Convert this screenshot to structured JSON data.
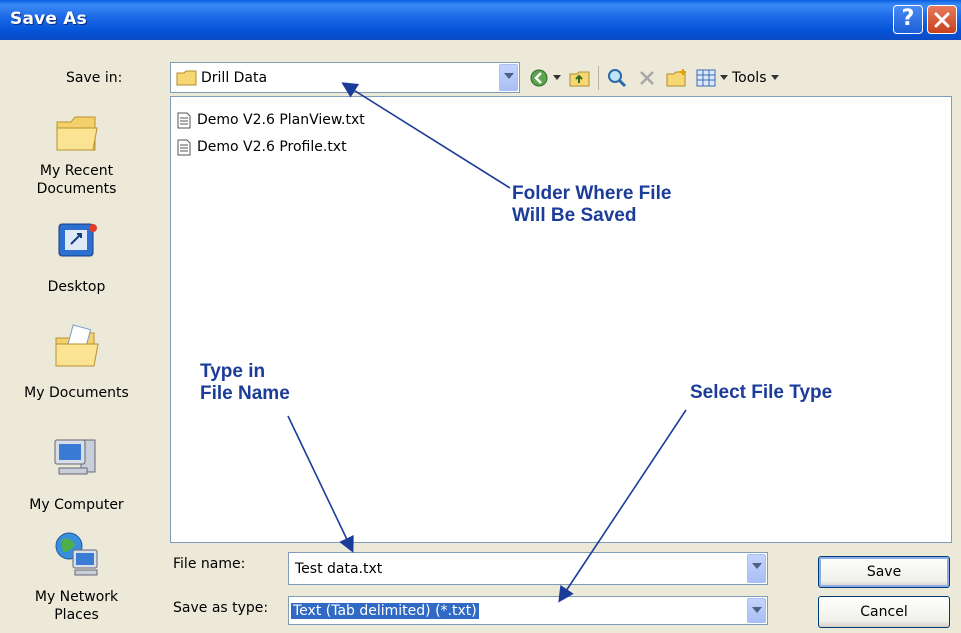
{
  "window": {
    "title": "Save As",
    "help_button": "?",
    "close_button": "✕"
  },
  "save_in": {
    "label": "Save in:",
    "value": "Drill Data"
  },
  "toolbar": {
    "tools_label": "Tools"
  },
  "places": [
    {
      "label": "My Recent Documents",
      "icon": "folder-recent-icon"
    },
    {
      "label": "Desktop",
      "icon": "desktop-icon"
    },
    {
      "label": "My Documents",
      "icon": "my-documents-icon"
    },
    {
      "label": "My Computer",
      "icon": "my-computer-icon"
    },
    {
      "label": "My Network Places",
      "icon": "network-places-icon"
    }
  ],
  "places_labels": {
    "recent_1": "My Recent",
    "recent_2": "Documents",
    "desktop": "Desktop",
    "mydocs": "My Documents",
    "mycomp": "My Computer",
    "network_1": "My Network",
    "network_2": "Places"
  },
  "files": [
    {
      "name": "Demo V2.6 PlanView.txt"
    },
    {
      "name": "Demo V2.6 Profile.txt"
    }
  ],
  "file_name": {
    "label": "File name:",
    "value": "Test data.txt"
  },
  "save_as_type": {
    "label": "Save as type:",
    "value": "Text (Tab delimited) (*.txt)"
  },
  "buttons": {
    "save": "Save",
    "cancel": "Cancel"
  },
  "annotations": {
    "folder_line1": "Folder Where File",
    "folder_line2": "Will Be Saved",
    "type_line1": "Type in",
    "type_line2": "File Name",
    "select_type": "Select File Type"
  },
  "colors": {
    "titlebar": "#0a5ee0",
    "annotation": "#1c3c99",
    "selection": "#316ac5",
    "dialog_bg": "#ece9d8"
  }
}
